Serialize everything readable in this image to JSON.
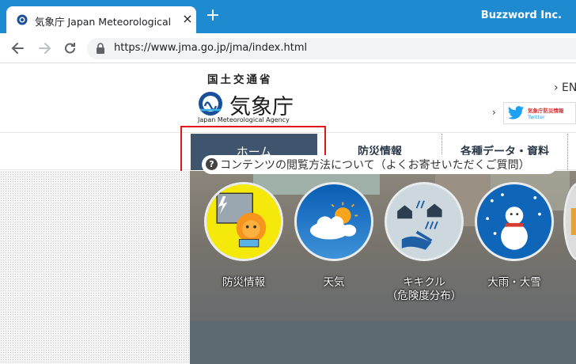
{
  "browser": {
    "tab_title": "気象庁 Japan Meteorological Agency",
    "tab_close": "×",
    "new_tab": "+",
    "profile": "Buzzword Inc.",
    "url": "https://www.jma.go.jp/jma/index.html"
  },
  "header": {
    "logo_top": "国土交通省",
    "logo_main": "気象庁",
    "logo_en": "Japan Meteorological Agency",
    "en_link": "› EN",
    "twitter_chevron": "›",
    "twitter_label": "気象庁防災情報",
    "twitter_sub": "Twitter"
  },
  "nav": {
    "home": "ホーム",
    "bousai": "防災情報",
    "data": "各種データ・資料"
  },
  "help": {
    "icon": "?",
    "text": "コンテンツの閲覧方法について（よくお寄せいただくご質問）"
  },
  "tiles": [
    {
      "label": "防災情報"
    },
    {
      "label": "天気"
    },
    {
      "label": "キキクル",
      "sub": "（危険度分布）"
    },
    {
      "label": "大雨・大雪"
    }
  ],
  "colors": {
    "tab_bar": "#1e8ad0",
    "nav_active": "#3e556d",
    "highlight": "#e0161b"
  }
}
